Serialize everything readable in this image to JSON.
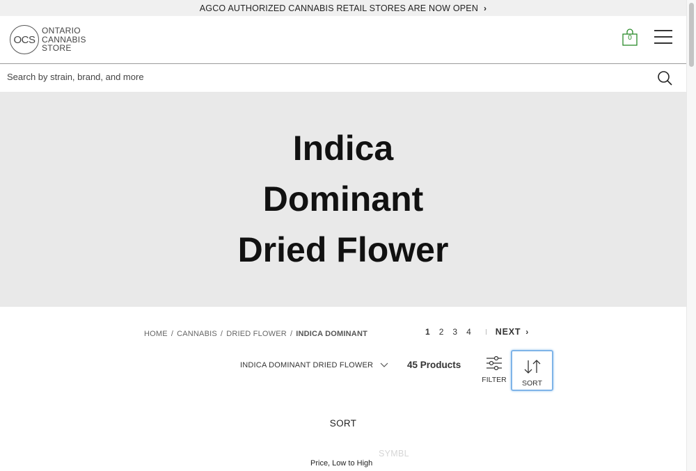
{
  "announcement": {
    "text": "AGCO AUTHORIZED CANNABIS RETAIL STORES ARE NOW OPEN",
    "icon": "chevron-right-icon"
  },
  "header": {
    "logo": {
      "mark": "OCS",
      "line1": "ONTARIO",
      "line2": "CANNABIS",
      "line3": "STORE"
    },
    "cart": {
      "count": "0",
      "icon": "shopping-bag-icon",
      "color": "#2a8a2a"
    },
    "menu_icon": "hamburger-menu-icon"
  },
  "search": {
    "placeholder": "Search by strain, brand, and more",
    "value": "",
    "icon": "search-icon"
  },
  "hero": {
    "title_line1": "Indica",
    "title_line2": "Dominant",
    "title_line3": "Dried Flower",
    "background": "#e9e9e9"
  },
  "breadcrumb": {
    "items": [
      "HOME",
      "CANNABIS",
      "DRIED FLOWER"
    ],
    "current": "INDICA DOMINANT",
    "separator": "/"
  },
  "pagination": {
    "pages": [
      "1",
      "2",
      "3",
      "4"
    ],
    "active": "1",
    "next_label": "NEXT"
  },
  "toolbar": {
    "category_label": "INDICA DOMINANT DRIED FLOWER",
    "product_count": "45 Products",
    "filter_label": "FILTER",
    "sort_label": "SORT",
    "focus_color": "#7fb4e8"
  },
  "sort_panel": {
    "heading": "SORT",
    "option": "Price, Low to High",
    "behind_text": "SYMBL"
  }
}
